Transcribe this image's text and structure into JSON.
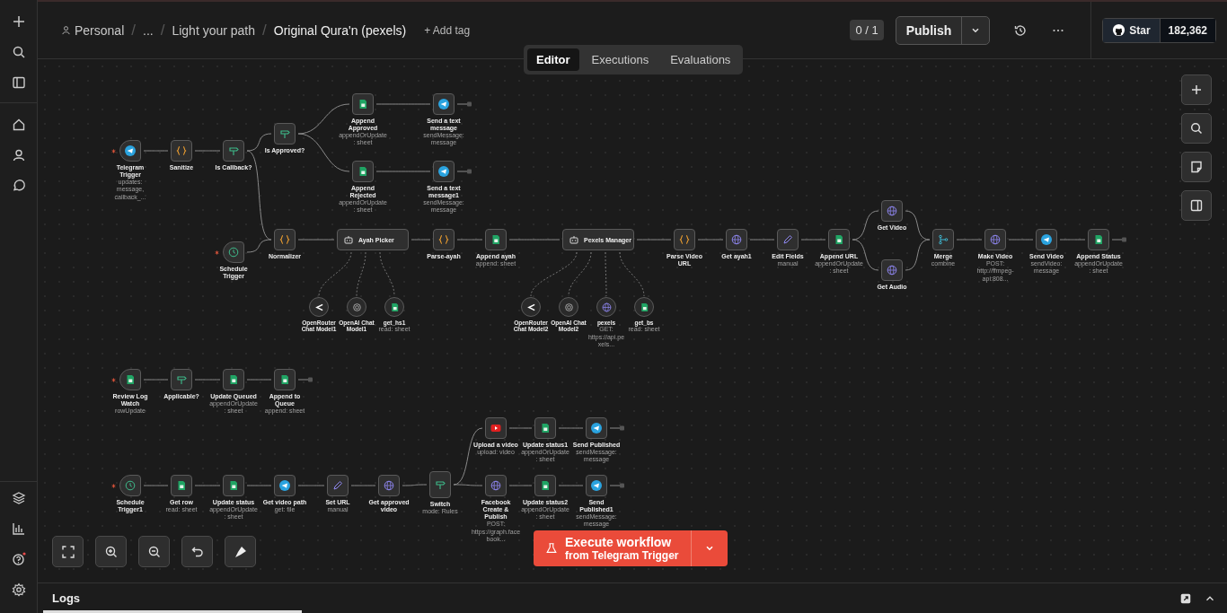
{
  "top_bar": {
    "breadcrumbs": [
      "Personal",
      "...",
      "Light your path"
    ],
    "separator": "/",
    "title": "Original Qura'n (pexels)",
    "add_tag": "+ Add tag",
    "version": "0 / 1",
    "publish": "Publish",
    "github": {
      "label": "Star",
      "count": "182,362"
    }
  },
  "tabs": [
    {
      "label": "Editor",
      "selected": true
    },
    {
      "label": "Executions",
      "selected": false
    },
    {
      "label": "Evaluations",
      "selected": false
    }
  ],
  "nodes": [
    {
      "name": "Telegram Trigger",
      "subtitle": "updates: message, callback_...",
      "kind": "trigger"
    },
    {
      "name": "Sanitize",
      "kind": "node"
    },
    {
      "name": "Is Callback?",
      "kind": "node"
    },
    {
      "name": "Is Approved?",
      "kind": "node"
    },
    {
      "name": "Append Approved",
      "subtitle": "appendOrUpdate: sheet",
      "kind": "node"
    },
    {
      "name": "Send a text message",
      "subtitle": "sendMessage: message",
      "kind": "node"
    },
    {
      "name": "Append Rejected",
      "subtitle": "appendOrUpdate: sheet",
      "kind": "node"
    },
    {
      "name": "Send a text message1",
      "subtitle": "sendMessage: message",
      "kind": "node"
    },
    {
      "name": "Schedule Trigger",
      "kind": "trigger"
    },
    {
      "name": "Normalizer",
      "kind": "node"
    },
    {
      "name": "Ayah Picker",
      "kind": "agent"
    },
    {
      "name": "Parse-ayah",
      "kind": "node"
    },
    {
      "name": "Append ayah",
      "subtitle": "append: sheet",
      "kind": "node"
    },
    {
      "name": "Pexels Manager",
      "kind": "agent"
    },
    {
      "name": "Parse Video URL",
      "kind": "node"
    },
    {
      "name": "Get ayah1",
      "kind": "node"
    },
    {
      "name": "Edit Fields",
      "subtitle": "manual",
      "kind": "node"
    },
    {
      "name": "Append URL",
      "subtitle": "appendOrUpdate: sheet",
      "kind": "node"
    },
    {
      "name": "Get Video",
      "kind": "node"
    },
    {
      "name": "Get Audio",
      "kind": "node"
    },
    {
      "name": "Merge",
      "subtitle": "combine",
      "kind": "node"
    },
    {
      "name": "Make Video",
      "subtitle": "POST: http://ffmpeg-api:808...",
      "kind": "node"
    },
    {
      "name": "Send Video",
      "subtitle": "sendVideo: message",
      "kind": "node"
    },
    {
      "name": "Append Status",
      "subtitle": "appendOrUpdate: sheet",
      "kind": "node"
    },
    {
      "name": "OpenRouter Chat Model1",
      "kind": "tool"
    },
    {
      "name": "OpenAI Chat Model1",
      "kind": "tool"
    },
    {
      "name": "get_hs1",
      "subtitle": "read: sheet",
      "kind": "tool"
    },
    {
      "name": "OpenRouter Chat Model2",
      "kind": "tool"
    },
    {
      "name": "OpenAI Chat Model2",
      "kind": "tool"
    },
    {
      "name": "pexels",
      "subtitle": "GET: https://api.pexels...",
      "kind": "tool"
    },
    {
      "name": "get_bs",
      "subtitle": "read: sheet",
      "kind": "tool"
    },
    {
      "name": "Review Log Watch",
      "subtitle": "rowUpdate",
      "kind": "trigger"
    },
    {
      "name": "Applicable?",
      "kind": "node"
    },
    {
      "name": "Update Queued",
      "subtitle": "appendOrUpdate: sheet",
      "kind": "node"
    },
    {
      "name": "Append to Queue",
      "subtitle": "append: sheet",
      "kind": "node"
    },
    {
      "name": "Schedule Trigger1",
      "kind": "trigger"
    },
    {
      "name": "Get row",
      "subtitle": "read: sheet",
      "kind": "node"
    },
    {
      "name": "Update status",
      "subtitle": "appendOrUpdate: sheet",
      "kind": "node"
    },
    {
      "name": "Get video path",
      "subtitle": "get: file",
      "kind": "node"
    },
    {
      "name": "Set URL",
      "subtitle": "manual",
      "kind": "node"
    },
    {
      "name": "Get approved video",
      "kind": "node"
    },
    {
      "name": "Switch",
      "subtitle": "mode: Rules",
      "kind": "node"
    },
    {
      "name": "Upload a video",
      "subtitle": "upload: video",
      "kind": "node"
    },
    {
      "name": "Update status1",
      "subtitle": "appendOrUpdate: sheet",
      "kind": "node"
    },
    {
      "name": "Send Published",
      "subtitle": "sendMessage: message",
      "kind": "node"
    },
    {
      "name": "Facebook Create & Publish",
      "subtitle": "POST: https://graph.facebook...",
      "kind": "node"
    },
    {
      "name": "Update status2",
      "subtitle": "appendOrUpdate: sheet",
      "kind": "node"
    },
    {
      "name": "Send Published1",
      "subtitle": "sendMessage: message",
      "kind": "node"
    }
  ],
  "execute": {
    "label": "Execute workflow",
    "trigger": "from Telegram Trigger"
  },
  "logs": {
    "label": "Logs"
  }
}
